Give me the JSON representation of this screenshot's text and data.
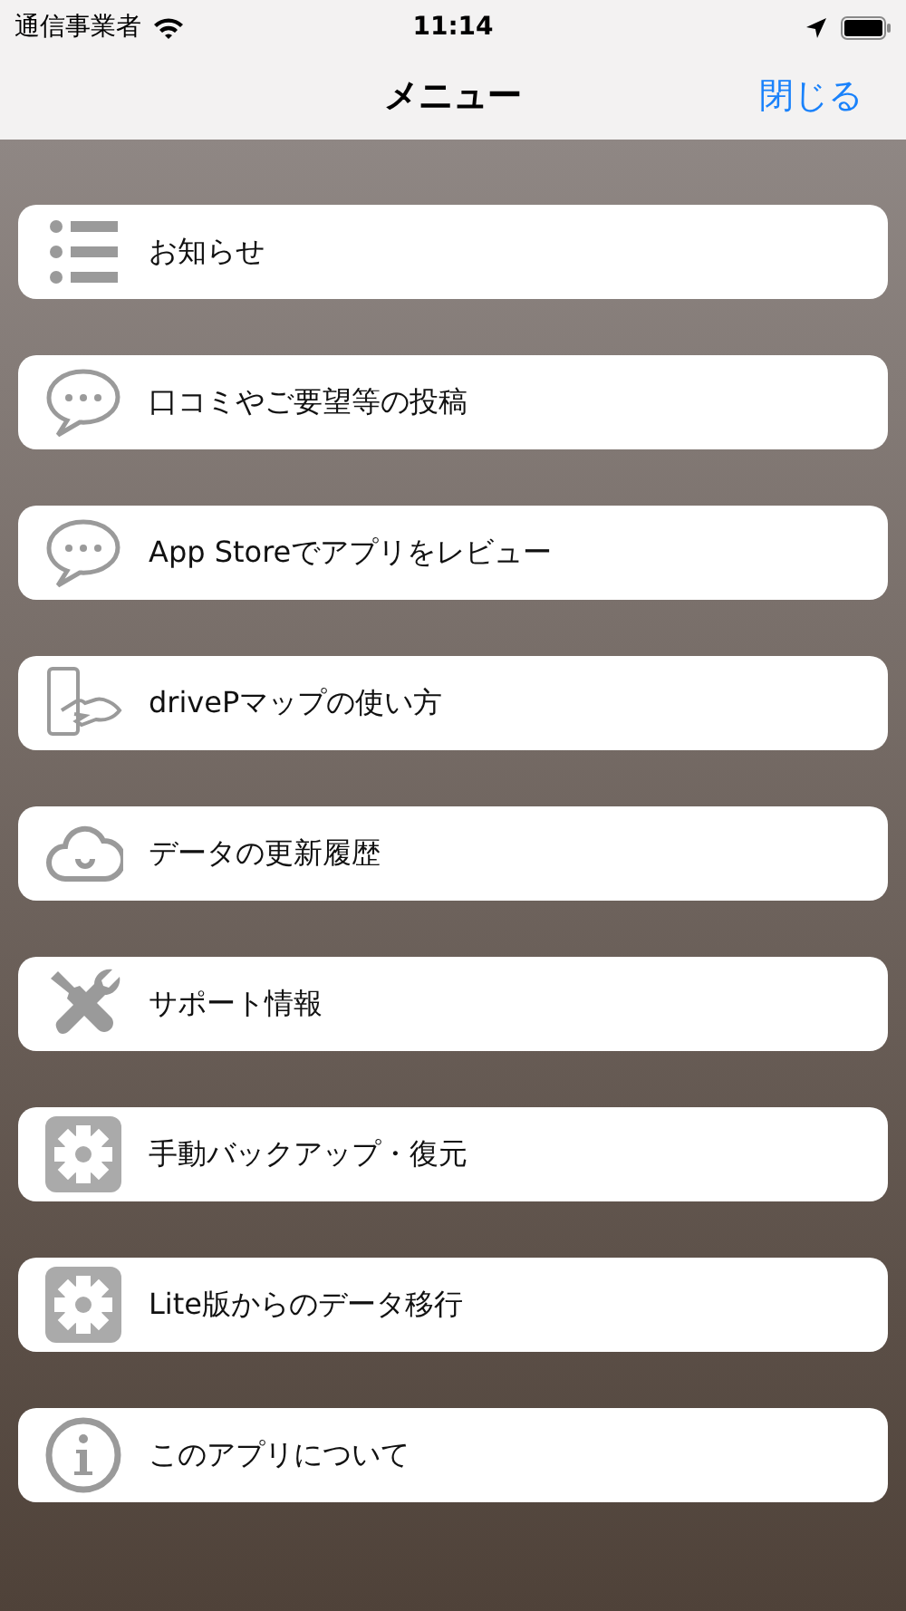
{
  "status_bar": {
    "carrier": "通信事業者",
    "time": "11:14"
  },
  "nav": {
    "title": "メニュー",
    "close": "閉じる"
  },
  "items": [
    {
      "kind": "list",
      "label": "お知らせ"
    },
    {
      "kind": "chat",
      "label": "口コミやご要望等の投稿"
    },
    {
      "kind": "chat",
      "label": "App Storeでアプリをレビュー"
    },
    {
      "kind": "phone",
      "label": "drivePマップの使い方"
    },
    {
      "kind": "cloud",
      "label": "データの更新履歴"
    },
    {
      "kind": "tools",
      "label": "サポート情報"
    },
    {
      "kind": "gear",
      "label": "手動バックアップ・復元"
    },
    {
      "kind": "gear",
      "label": "Lite版からのデータ移行"
    },
    {
      "kind": "info",
      "label": "このアプリについて"
    }
  ]
}
